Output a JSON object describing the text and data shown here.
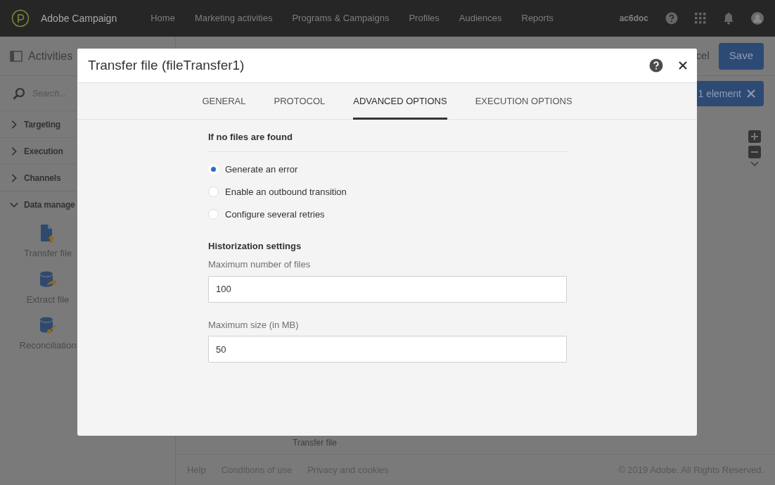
{
  "app": {
    "name": "Adobe Campaign"
  },
  "nav": {
    "items": [
      "Home",
      "Marketing activities",
      "Programs & Campaigns",
      "Profiles",
      "Audiences",
      "Reports"
    ],
    "user": "ac6doc"
  },
  "sidebar": {
    "title": "Activities",
    "search": {
      "placeholder": "Search..."
    },
    "groups": [
      {
        "label": "Targeting",
        "expanded": false
      },
      {
        "label": "Execution",
        "expanded": false
      },
      {
        "label": "Channels",
        "expanded": false
      },
      {
        "label": "Data manage",
        "expanded": true,
        "items": [
          {
            "label": "Transfer file",
            "kind": "transfer"
          },
          {
            "label": "Extract file",
            "kind": "extract"
          },
          {
            "label": "Reconciliation",
            "kind": "reconciliation"
          }
        ]
      }
    ]
  },
  "toolbar": {
    "cancel": "cel",
    "save": "Save",
    "selection": "1 element"
  },
  "canvas": {
    "node_label": "Transfer file"
  },
  "footer": {
    "links": [
      "Help",
      "Conditions of use",
      "Privacy and cookies"
    ],
    "copyright": "© 2019 Adobe. All Rights Reserved."
  },
  "dialog": {
    "title": "Transfer file (fileTransfer1)",
    "tabs": [
      {
        "label": "GENERAL",
        "selected": false
      },
      {
        "label": "PROTOCOL",
        "selected": false
      },
      {
        "label": "ADVANCED OPTIONS",
        "selected": true
      },
      {
        "label": "EXECUTION OPTIONS",
        "selected": false
      }
    ],
    "no_files": {
      "heading": "If no files are found",
      "options": [
        {
          "label": "Generate an error",
          "selected": true
        },
        {
          "label": "Enable an outbound transition",
          "selected": false
        },
        {
          "label": "Configure several retries",
          "selected": false
        }
      ]
    },
    "historization": {
      "heading": "Historization settings",
      "fields": [
        {
          "label": "Maximum number of files",
          "value": "100"
        },
        {
          "label": "Maximum size (in MB)",
          "value": "50"
        }
      ]
    }
  }
}
